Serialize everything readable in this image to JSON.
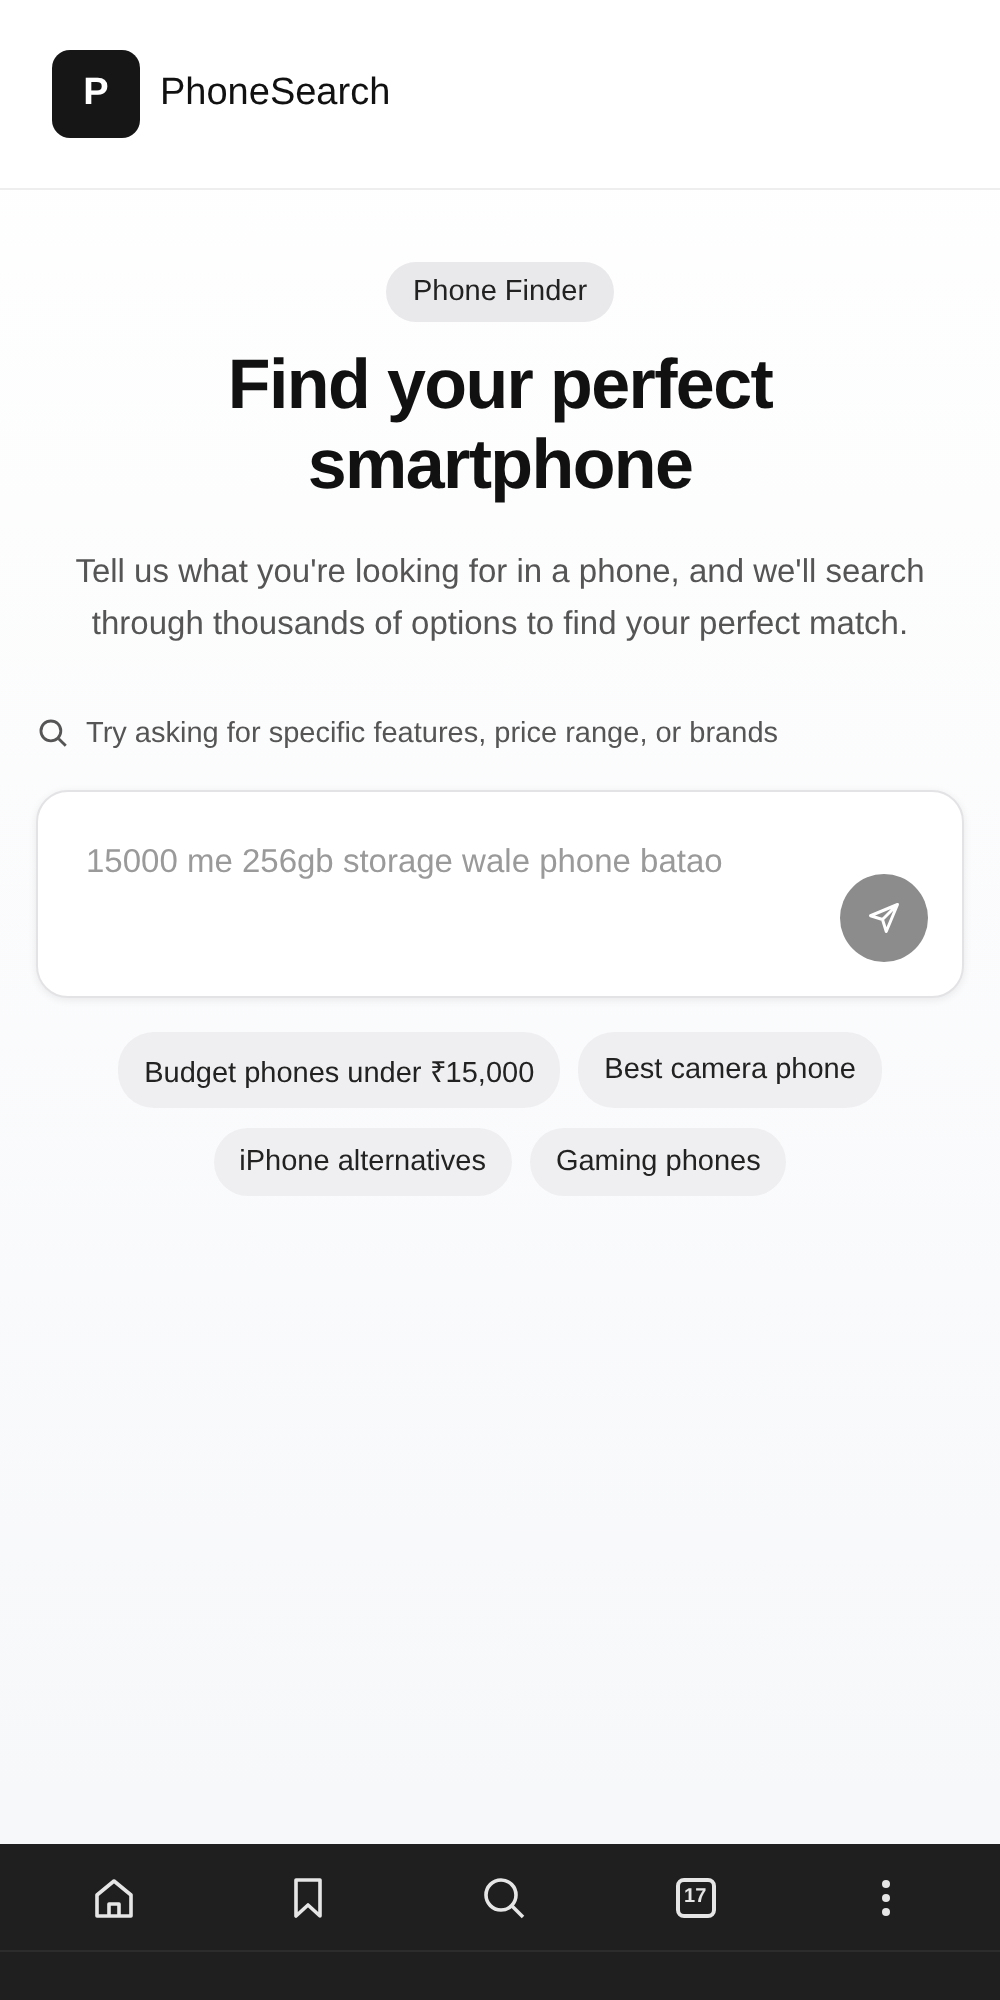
{
  "header": {
    "logo_letter": "P",
    "title": "PhoneSearch"
  },
  "hero": {
    "badge": "Phone Finder",
    "heading": "Find your perfect smartphone",
    "description": "Tell us what you're looking for in a phone, and we'll search through thousands of options to find your perfect match."
  },
  "search": {
    "hint": "Try asking for specific features, price range, or brands",
    "placeholder": "15000 me 256gb storage wale phone batao"
  },
  "suggestions": [
    "Budget phones under ₹15,000",
    "Best camera phone",
    "iPhone alternatives",
    "Gaming phones"
  ],
  "browser_bar": {
    "tab_count": "17"
  }
}
